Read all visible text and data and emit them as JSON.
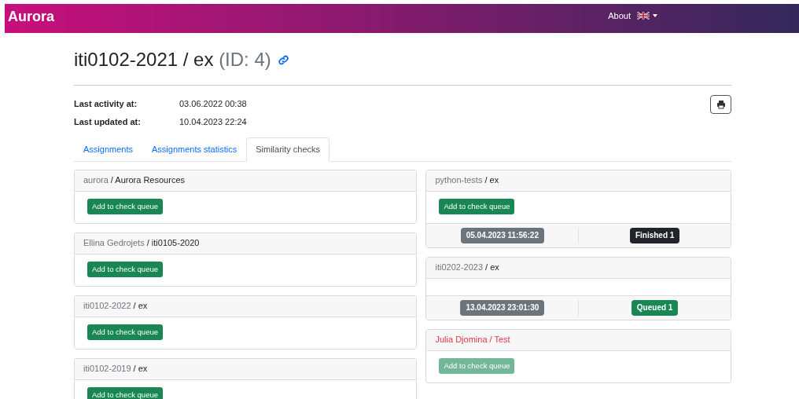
{
  "navbar": {
    "brand": "Aurora",
    "links": [
      {
        "label": "About"
      }
    ]
  },
  "title": {
    "main": "iti0102-2021 / ex",
    "id_text": "(ID: 4)"
  },
  "card_separator": "/",
  "info": [
    {
      "label": "Last activity at:",
      "value": "03.06.2022 00:38"
    },
    {
      "label": "Last updated at:",
      "value": "10.04.2023 22:24"
    }
  ],
  "tabs": [
    {
      "label": "Assignments",
      "selected": false
    },
    {
      "label": "Assignments statistics",
      "selected": false
    },
    {
      "label": "Similarity checks",
      "selected": true
    }
  ],
  "columns": [
    [
      {
        "owner": "aurora",
        "name": "Aurora Resources",
        "alert": false,
        "button": {
          "label": "Add to check queue",
          "disabled": false
        }
      },
      {
        "owner": "Ellina Gedrojets",
        "name": "iti0105-2020",
        "alert": false,
        "button": {
          "label": "Add to check queue",
          "disabled": false
        }
      },
      {
        "owner": "iti0102-2022",
        "name": "ex",
        "alert": false,
        "button": {
          "label": "Add to check queue",
          "disabled": false
        }
      },
      {
        "owner": "iti0102-2019",
        "name": "ex",
        "alert": false,
        "button": {
          "label": "Add to check queue",
          "disabled": false
        }
      }
    ],
    [
      {
        "owner": "python-tests",
        "name": "ex",
        "alert": false,
        "button": {
          "label": "Add to check queue",
          "disabled": false
        },
        "check": {
          "time": "05.04.2023 11:56:22",
          "status": "Finished 1",
          "kind": "finished"
        }
      },
      {
        "owner": "iti0202-2023",
        "name": "ex",
        "alert": false,
        "check": {
          "time": "13.04.2023 23:01:30",
          "status": "Queued 1",
          "kind": "queued"
        }
      },
      {
        "owner": "Julia Djomina",
        "name": "Test",
        "alert": true,
        "button": {
          "label": "Add to check queue",
          "disabled": true
        }
      }
    ]
  ]
}
